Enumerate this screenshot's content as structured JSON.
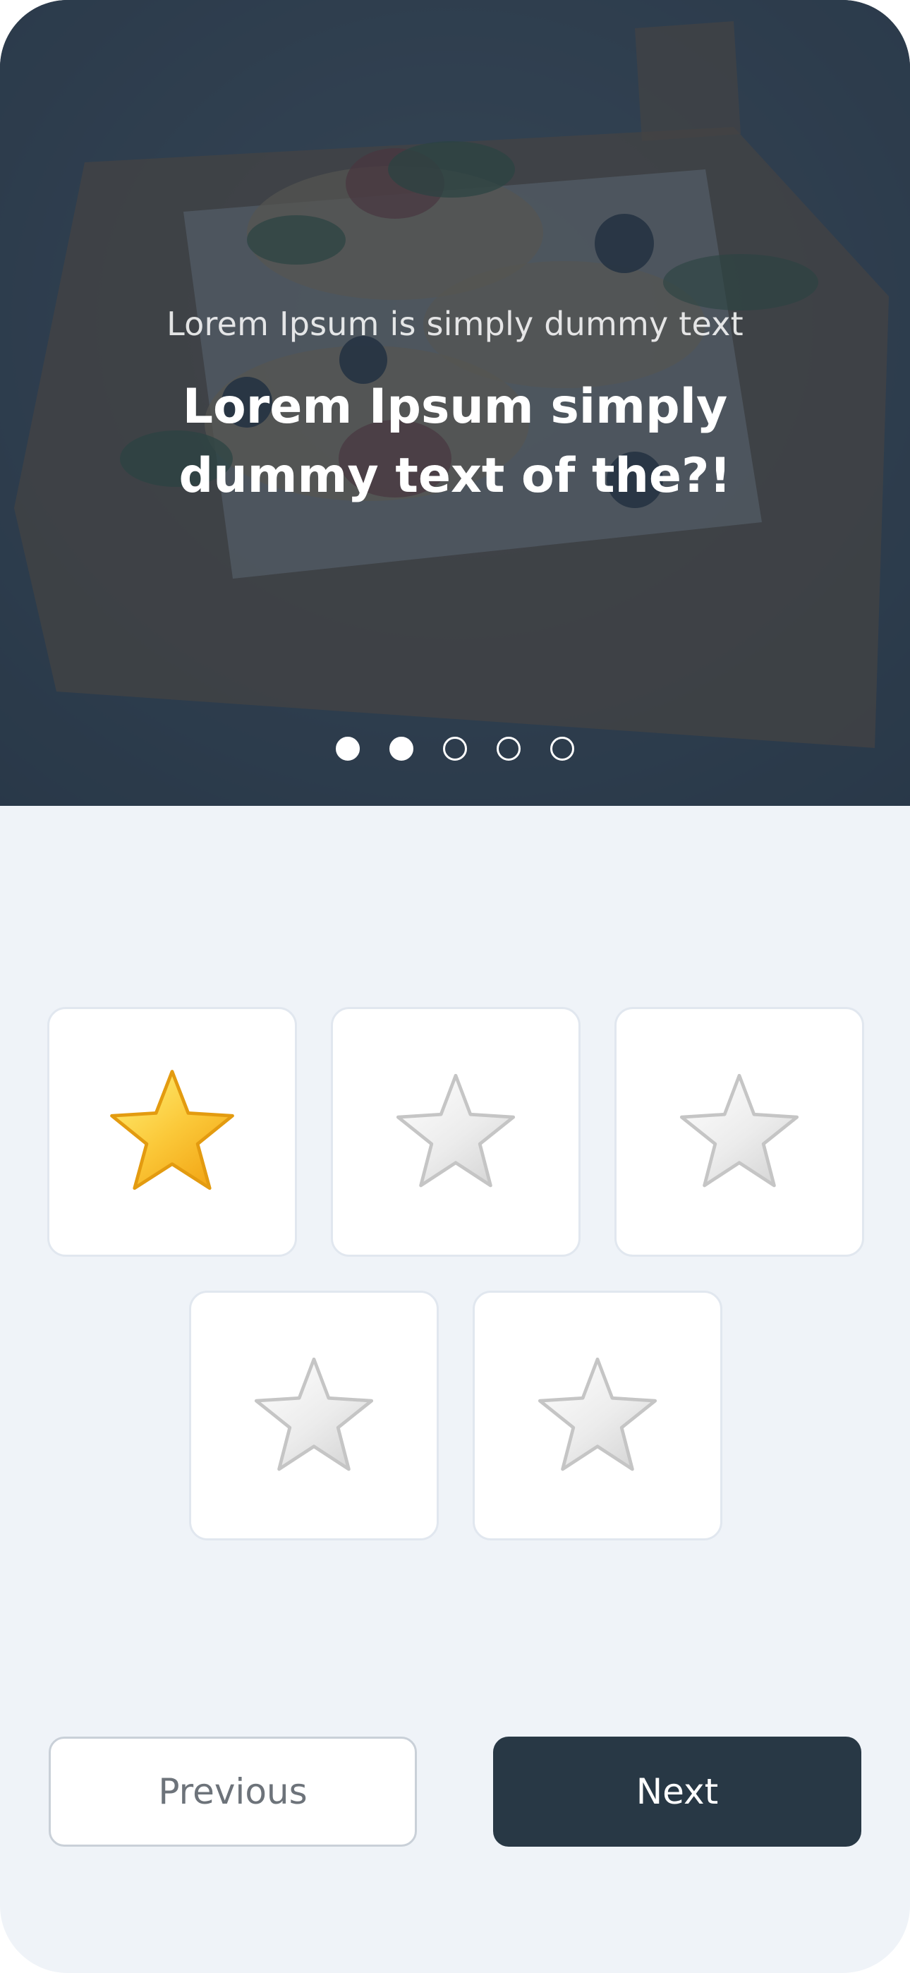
{
  "hero": {
    "subtitle": "Lorem Ipsum is simply dummy text",
    "title": "Lorem Ipsum simply dummy text of the?!",
    "background_image": "bruschetta-on-wooden-board",
    "overlay_color": "#283a4c"
  },
  "pagination": {
    "total": 5,
    "filled": [
      true,
      true,
      false,
      false,
      false
    ]
  },
  "rating": {
    "options": 5,
    "selected": 1,
    "star_colors": {
      "active": "#f9c21b",
      "inactive": "#e8e8e8"
    }
  },
  "buttons": {
    "previous_label": "Previous",
    "next_label": "Next"
  },
  "colors": {
    "background": "#eff3f8",
    "primary": "#283845",
    "card_border": "#e1e7ef"
  }
}
